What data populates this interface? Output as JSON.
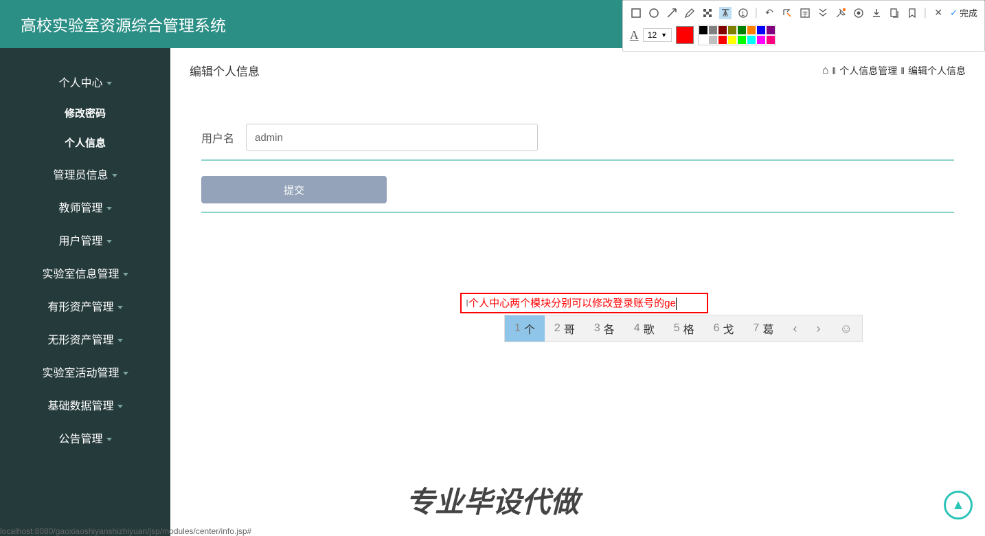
{
  "header": {
    "title": "高校实验室资源综合管理系统"
  },
  "sidebar": {
    "items": [
      {
        "label": "个人中心",
        "caret": true
      },
      {
        "label": "修改密码",
        "sub": true
      },
      {
        "label": "个人信息",
        "sub": true
      },
      {
        "label": "管理员信息",
        "caret": true
      },
      {
        "label": "教师管理",
        "caret": true
      },
      {
        "label": "用户管理",
        "caret": true
      },
      {
        "label": "实验室信息管理",
        "caret": true
      },
      {
        "label": "有形资产管理",
        "caret": true
      },
      {
        "label": "无形资产管理",
        "caret": true
      },
      {
        "label": "实验室活动管理",
        "caret": true
      },
      {
        "label": "基础数据管理",
        "caret": true
      },
      {
        "label": "公告管理",
        "caret": true
      }
    ]
  },
  "page": {
    "title": "编辑个人信息",
    "breadcrumb": {
      "sep": "‖",
      "a": "个人信息管理",
      "b": "编辑个人信息"
    }
  },
  "form": {
    "username_label": "用户名",
    "username_value": "admin",
    "submit_label": "提交"
  },
  "annotation": {
    "text": "个人中心两个模块分别可以修改登录账号的ge"
  },
  "ime": {
    "items": [
      {
        "n": "1",
        "c": "个"
      },
      {
        "n": "2",
        "c": "哥"
      },
      {
        "n": "3",
        "c": "各"
      },
      {
        "n": "4",
        "c": "歌"
      },
      {
        "n": "5",
        "c": "格"
      },
      {
        "n": "6",
        "c": "戈"
      },
      {
        "n": "7",
        "c": "葛"
      }
    ]
  },
  "watermark": "专业毕设代做",
  "status_url": "localhost:8080/gaoxiaoshiyanshizhiyuan/jsp/modules/center/info.jsp#",
  "toolbar": {
    "font_size": "12",
    "done": "完成",
    "main_color": "#ff0000",
    "palette": [
      [
        "#000000",
        "#808080",
        "#800000",
        "#808000",
        "#008000",
        "#ff8000",
        "#0000ff",
        "#800080"
      ],
      [
        "#ffffff",
        "#c0c0c0",
        "#ff0000",
        "#ffff00",
        "#00ff00",
        "#00ffff",
        "#ff00ff",
        "#ff0080"
      ]
    ]
  }
}
